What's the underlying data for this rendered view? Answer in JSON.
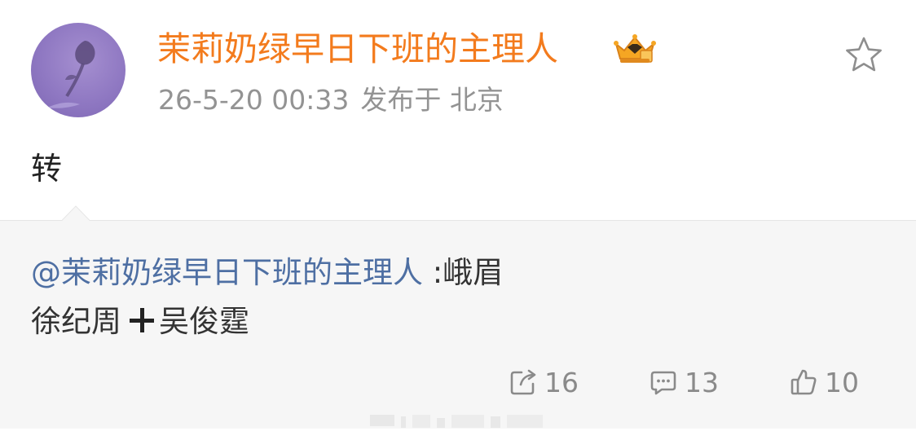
{
  "post": {
    "author": "茉莉奶绿早日下班的主理人",
    "date": "26-5-20 00:33",
    "location": "发布于 北京",
    "text": "转",
    "badge_icon": "vip-crown-icon",
    "favorite_icon": "star-outline-icon"
  },
  "original": {
    "mention": "@茉莉奶绿早日下班的主理人",
    "text_line1": " :峨眉",
    "text_line2_a": "徐纪周",
    "text_line2_b": "吴俊霆",
    "plus_icon": "plus-icon"
  },
  "actions": {
    "repost": {
      "icon": "repost-icon",
      "count": "16"
    },
    "comment": {
      "icon": "comment-icon",
      "count": "13"
    },
    "like": {
      "icon": "thumbs-up-icon",
      "count": "10"
    }
  },
  "colors": {
    "username": "#f37b1d",
    "mention": "#4e6fa3",
    "meta": "#939393",
    "repost_bg": "#f6f6f6"
  }
}
